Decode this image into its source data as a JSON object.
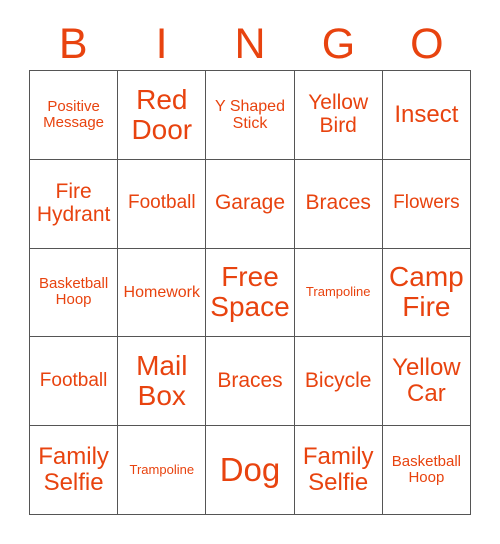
{
  "card": {
    "title": "BINGO",
    "accent_color": "#e8430f",
    "grid_line_color": "#555555",
    "background_color": "#ffffff",
    "header": {
      "letters": [
        "B",
        "I",
        "N",
        "G",
        "O"
      ]
    },
    "columns": 5,
    "rows": 5,
    "free_space_label": "Free Space",
    "cells": [
      [
        {
          "label": "Positive Message",
          "size": "fs-s"
        },
        {
          "label": "Red Door",
          "size": "fs-xl"
        },
        {
          "label": "Y Shaped Stick",
          "size": "fs-sm"
        },
        {
          "label": "Yellow Bird",
          "size": "fs-ml"
        },
        {
          "label": "Insect",
          "size": "fs-l"
        }
      ],
      [
        {
          "label": "Fire Hydrant",
          "size": "fs-ml"
        },
        {
          "label": "Football",
          "size": "fs-m"
        },
        {
          "label": "Garage",
          "size": "fs-ml"
        },
        {
          "label": "Braces",
          "size": "fs-ml"
        },
        {
          "label": "Flowers",
          "size": "fs-m"
        }
      ],
      [
        {
          "label": "Basketball Hoop",
          "size": "fs-s"
        },
        {
          "label": "Homework",
          "size": "fs-sm"
        },
        {
          "label": "Free Space",
          "size": "fs-xl"
        },
        {
          "label": "Trampoline",
          "size": "fs-xs"
        },
        {
          "label": "Camp Fire",
          "size": "fs-xl"
        }
      ],
      [
        {
          "label": "Football",
          "size": "fs-m"
        },
        {
          "label": "Mail Box",
          "size": "fs-xl"
        },
        {
          "label": "Braces",
          "size": "fs-ml"
        },
        {
          "label": "Bicycle",
          "size": "fs-ml"
        },
        {
          "label": "Yellow Car",
          "size": "fs-l"
        }
      ],
      [
        {
          "label": "Family Selfie",
          "size": "fs-l"
        },
        {
          "label": "Trampoline",
          "size": "fs-xs"
        },
        {
          "label": "Dog",
          "size": "fs-xxl"
        },
        {
          "label": "Family Selfie",
          "size": "fs-l"
        },
        {
          "label": "Basketball Hoop",
          "size": "fs-s"
        }
      ]
    ]
  }
}
